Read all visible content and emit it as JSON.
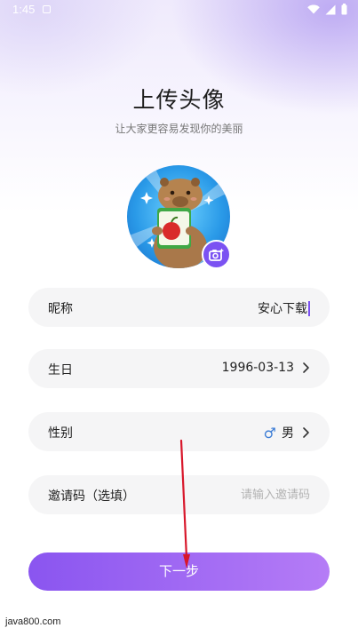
{
  "status_bar": {
    "time": "1:45"
  },
  "header": {
    "title": "上传头像",
    "subtitle": "让大家更容易发现你的美丽"
  },
  "form": {
    "nickname": {
      "label": "昵称",
      "value": "安心下载"
    },
    "birthday": {
      "label": "生日",
      "value": "1996-03-13"
    },
    "gender": {
      "label": "性别",
      "value": "男",
      "symbol": "♂"
    },
    "invite_code": {
      "label": "邀请码（选填）",
      "placeholder": "请输入邀请码"
    }
  },
  "next_button": {
    "label": "下一步"
  },
  "watermark": "java800.com",
  "colors": {
    "accent": "#7b52f2",
    "button_start": "#8a55f0",
    "button_end": "#b57cf6",
    "field_bg": "#f5f5f6",
    "arrow": "#d8172b"
  },
  "icons": {
    "status": [
      "notification-icon",
      "wifi-icon",
      "signal-icon",
      "battery-icon"
    ],
    "camera_badge": "camera-sparkle-icon",
    "chevron": "chevron-right-icon",
    "gender": "male-symbol-icon"
  }
}
